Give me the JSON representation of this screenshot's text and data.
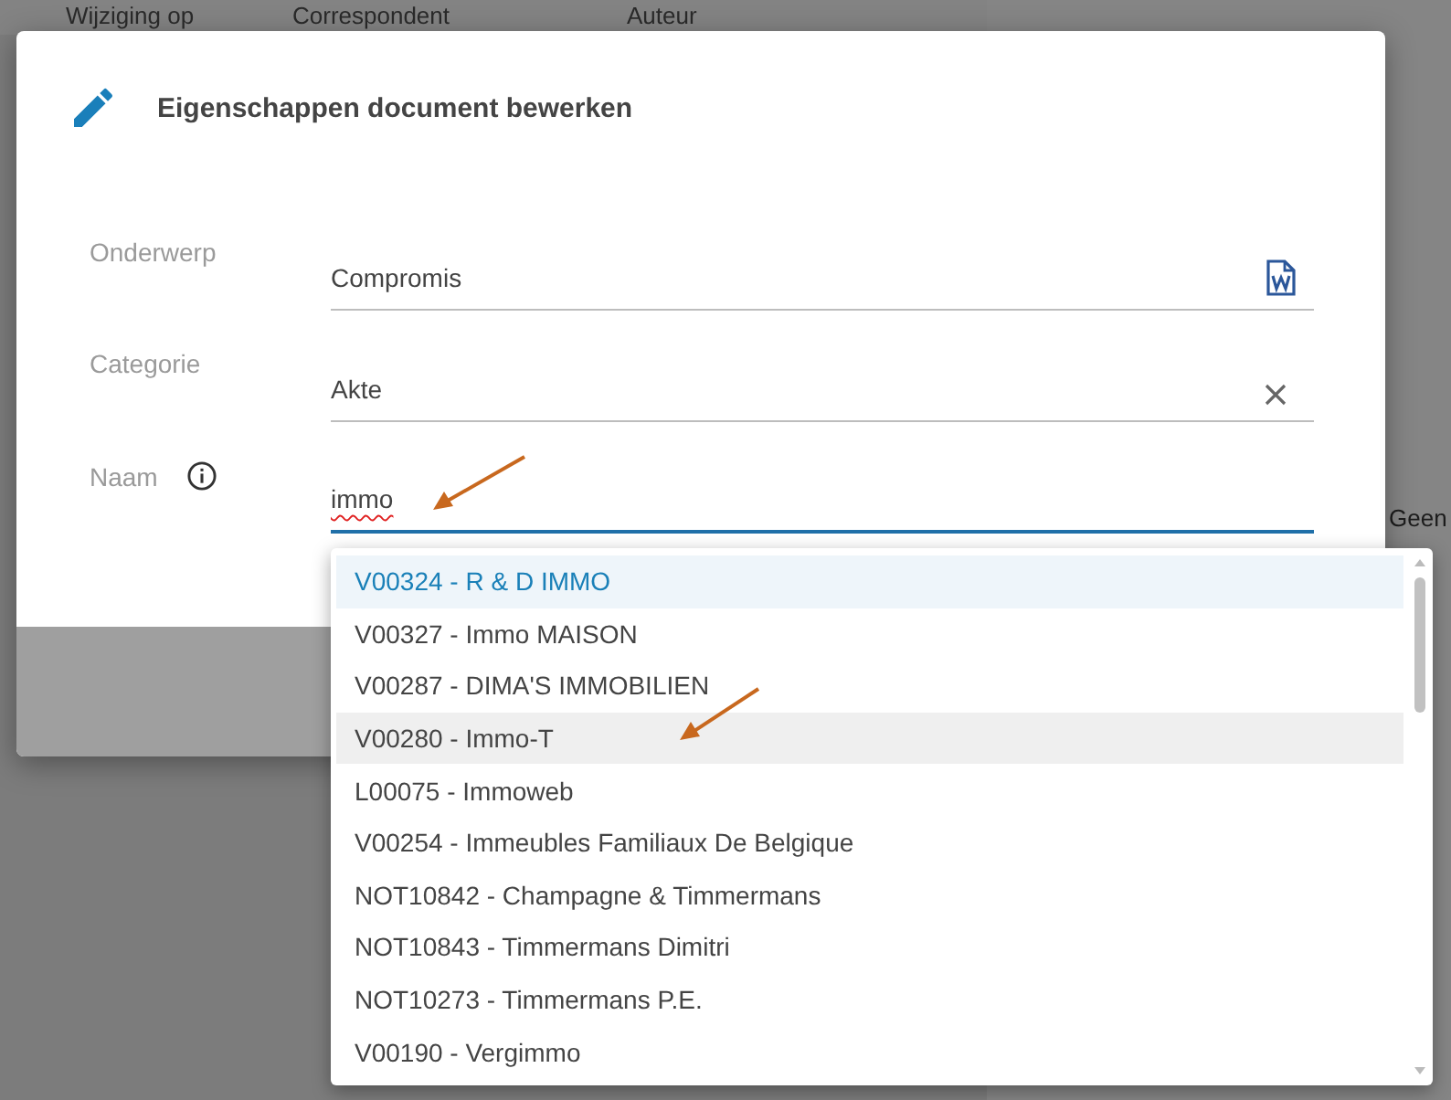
{
  "background": {
    "columns": [
      "Wijziging op",
      "Correspondent",
      "Auteur"
    ],
    "side_text": "Geen"
  },
  "dialog": {
    "title": "Eigenschappen document bewerken",
    "fields": [
      {
        "label": "Onderwerp",
        "value": "Compromis",
        "kind": "document"
      },
      {
        "label": "Categorie",
        "value": "Akte",
        "kind": "clearable"
      },
      {
        "label": "Naam",
        "value": "immo",
        "kind": "lookup"
      }
    ]
  },
  "dropdown": {
    "options": [
      {
        "label": "V00324 - R & D IMMO",
        "selected": true,
        "hovered": false
      },
      {
        "label": "V00327 - Immo MAISON",
        "selected": false,
        "hovered": false
      },
      {
        "label": "V00287 - DIMA'S IMMOBILIEN",
        "selected": false,
        "hovered": false
      },
      {
        "label": "V00280 - Immo-T",
        "selected": false,
        "hovered": true
      },
      {
        "label": "L00075 - Immoweb",
        "selected": false,
        "hovered": false
      },
      {
        "label": "V00254 - Immeubles Familiaux De Belgique",
        "selected": false,
        "hovered": false
      },
      {
        "label": "NOT10842 - Champagne & Timmermans",
        "selected": false,
        "hovered": false
      },
      {
        "label": "NOT10843 - Timmermans Dimitri",
        "selected": false,
        "hovered": false
      },
      {
        "label": "NOT10273 - Timmermans P.E.",
        "selected": false,
        "hovered": false
      },
      {
        "label": "V00190 - Vergimmo",
        "selected": false,
        "hovered": false
      }
    ]
  }
}
